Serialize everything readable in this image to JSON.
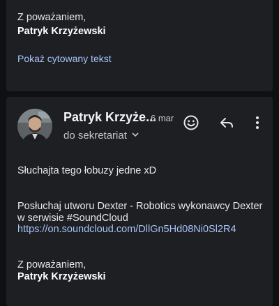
{
  "previous_message": {
    "closing": "Z poważaniem,",
    "signature_name": "Patryk Krzyżewski",
    "show_quoted_label": "Pokaż cytowany tekst"
  },
  "message": {
    "sender_name": "Patryk Krzyże...",
    "date": "6 mar",
    "recipient_line": "do sekretariat",
    "actions": {
      "emoji_icon": "add-reaction-icon",
      "reply_icon": "reply-icon",
      "more_icon": "more-vert-icon"
    },
    "body": {
      "line1": "Słuchajta tego łobuzy jedne xD",
      "line2": "Posłuchaj utworu Dexter - Robotics wykonawcy Dexter",
      "line3": "w serwisie #SoundCloud",
      "link": "https://on.soundcloud.com/DllGn5Hd08Ni0Sl2R4"
    },
    "closing": "Z poważaniem,",
    "signature_name": "Patryk Krzyżewski"
  },
  "colors": {
    "background": "#0f1012",
    "card": "#1d1f22",
    "link": "#a8c2f7"
  }
}
